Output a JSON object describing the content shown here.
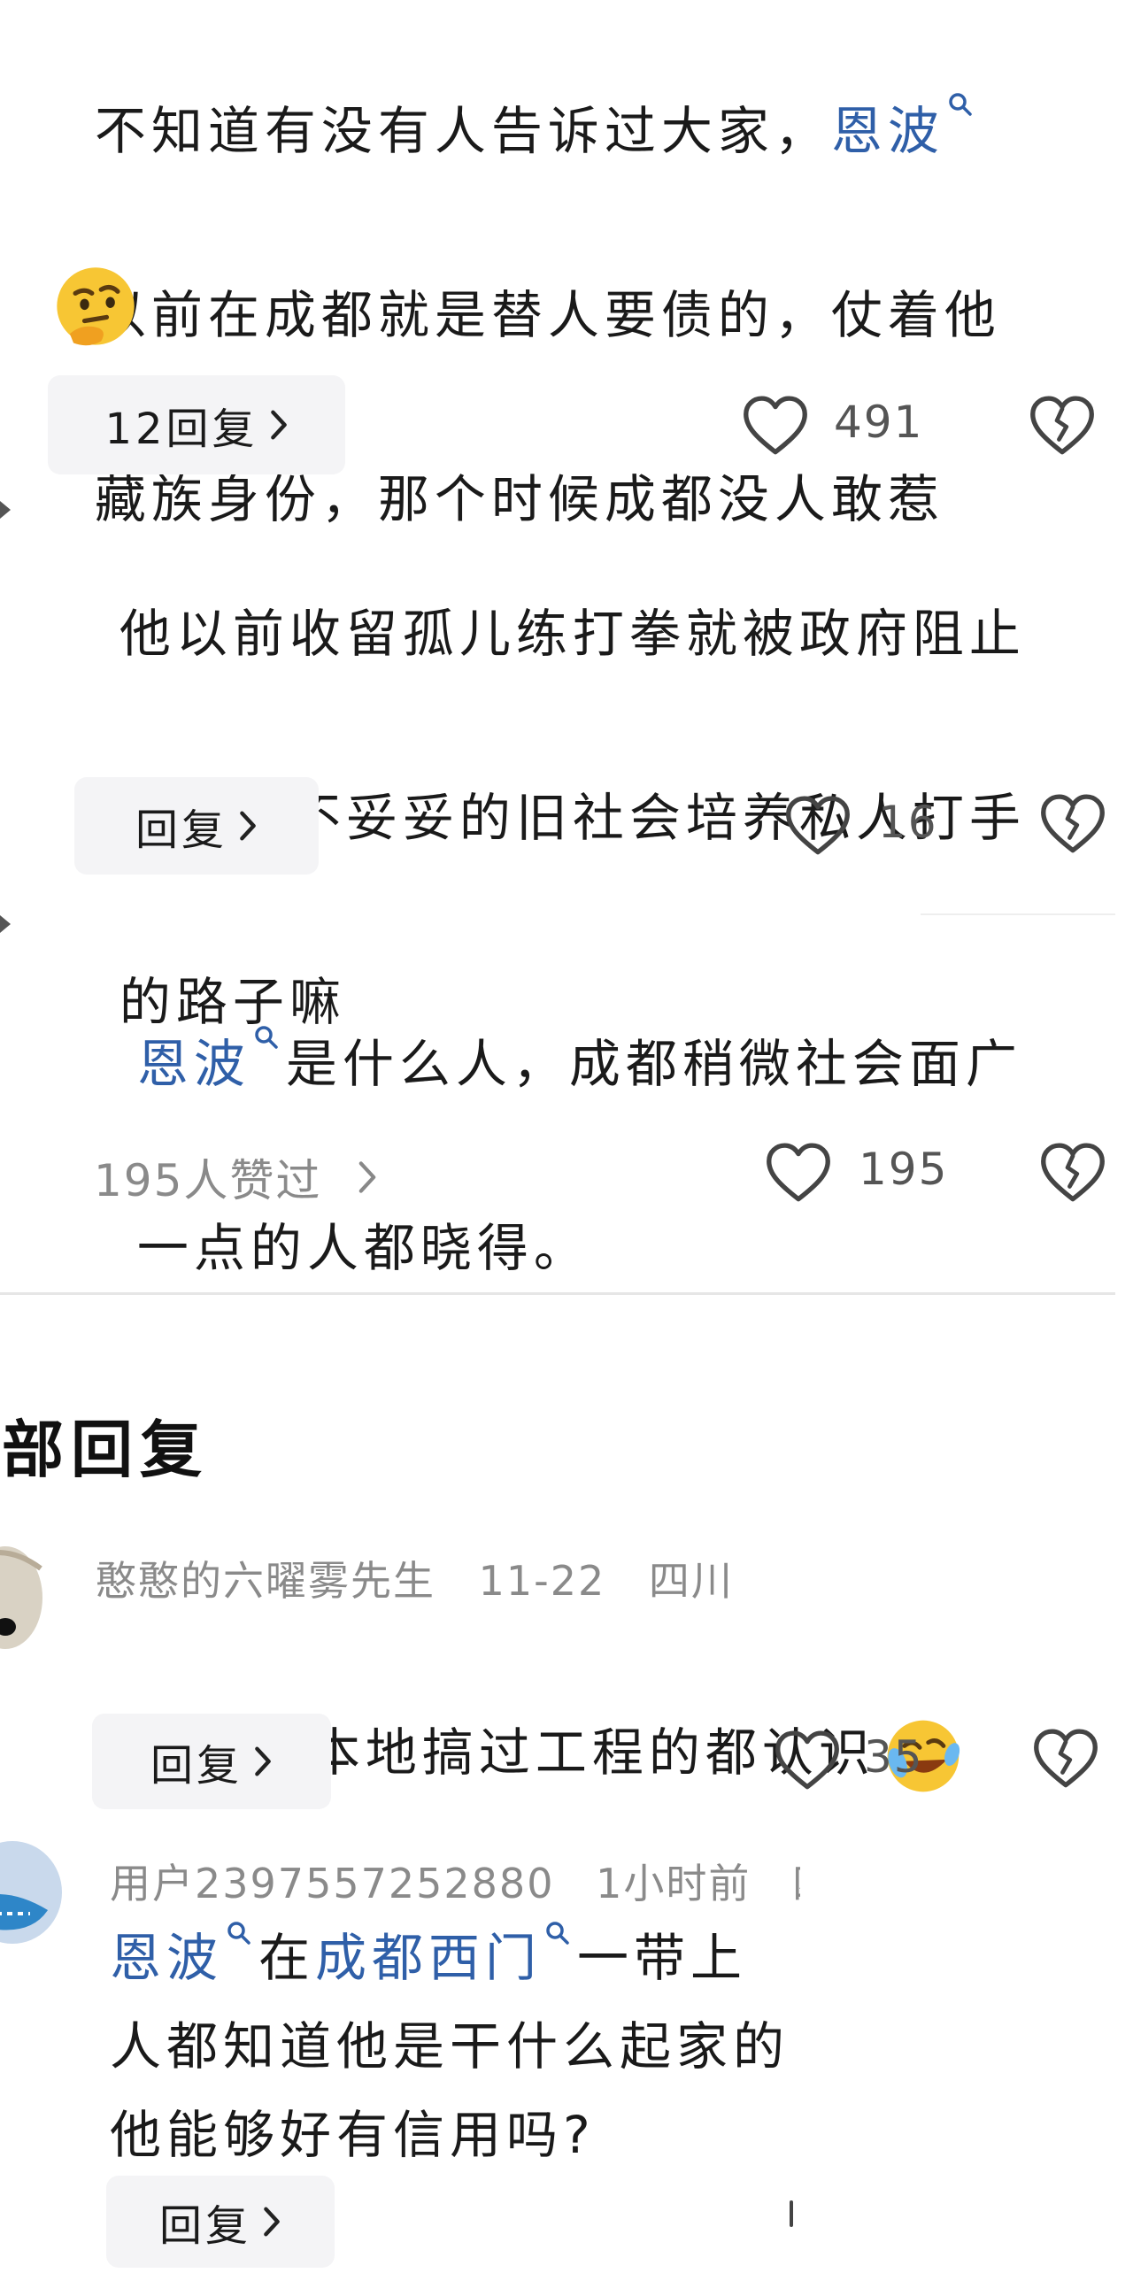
{
  "comments": [
    {
      "text_prefix": "不知道有没有人告诉过大家，",
      "mention": "恩波",
      "text_line2": "以前在成都就是替人要债的，仗着他",
      "text_line3": "藏族身份，那个时候成都没人敢惹",
      "reply_label": "12回复",
      "likes": "491"
    },
    {
      "text_line1": "他以前收留孤儿练打拳就被政府阻止",
      "text_line2": "了，这不妥妥的旧社会培养私人打手",
      "text_line3": "的路子嘛",
      "reply_label": "回复",
      "likes": "16"
    },
    {
      "mention": "恩波",
      "text_line1_rest": "是什么人，成都稍微社会面广",
      "text_line2": "一点的人都晓得。",
      "liked_by": "195人赞过",
      "likes": "195"
    }
  ],
  "all_replies": {
    "title": "部回复",
    "items": [
      {
        "username": "憨憨的六曜雾先生",
        "date": "11-22",
        "location": "四川",
        "text": "但凡在本地搞过工程的都认识",
        "reply_label": "回复",
        "likes": "35"
      },
      {
        "username": "用户2397557252880",
        "date": "1小时前",
        "location": "四",
        "mention1": "恩波",
        "mid_text": "在",
        "mention2": "成都西门",
        "text_line1_rest": "一带上",
        "text_line2": "人都知道他是干什么起家的",
        "text_line3": "他能够好有信用吗?",
        "reply_label": "回复"
      }
    ]
  },
  "colors": {
    "link": "#2f5fa8",
    "button_bg": "#f4f4f6",
    "divider": "#e6e6e6"
  }
}
